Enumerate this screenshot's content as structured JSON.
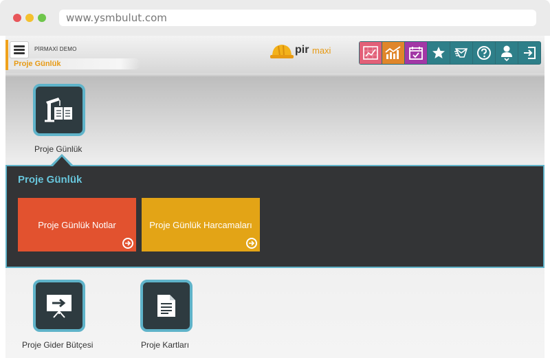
{
  "browser": {
    "url": "www.ysmbulut.com"
  },
  "header": {
    "company": "PİRMAXİ DEMO",
    "breadcrumb": "Proje Günlük",
    "logo_pir": "pir",
    "logo_maxi": "maxi"
  },
  "toolbar": {
    "buttons": [
      {
        "name": "report-icon",
        "color": "#e26078"
      },
      {
        "name": "chart-icon",
        "color": "#e0862a"
      },
      {
        "name": "calendar-check-icon",
        "color": "#a238a6"
      },
      {
        "name": "star-icon",
        "color": "#2e7f89"
      },
      {
        "name": "messages-icon",
        "color": "#2e7f89"
      },
      {
        "name": "help-icon",
        "color": "#2e7f89"
      },
      {
        "name": "user-icon",
        "color": "#2e7f89"
      },
      {
        "name": "logout-icon",
        "color": "#2e7f89"
      }
    ]
  },
  "modules": {
    "proje_gunluk": "Proje Günlük",
    "proje_gider_butcesi": "Proje Gider Bütçesi",
    "proje_kartlari": "Proje Kartları"
  },
  "panel": {
    "title": "Proje Günlük",
    "items": [
      {
        "label": "Proje Günlük Notlar",
        "color": "#e2522f"
      },
      {
        "label": "Proje Günlük Harcamaları",
        "color": "#e3a416"
      }
    ]
  },
  "colors": {
    "accent_orange": "#e79a14",
    "tile_border": "#5fb3c9",
    "tile_bg": "#2e3b40",
    "panel_bg": "#333436",
    "panel_title": "#68c6dc"
  }
}
